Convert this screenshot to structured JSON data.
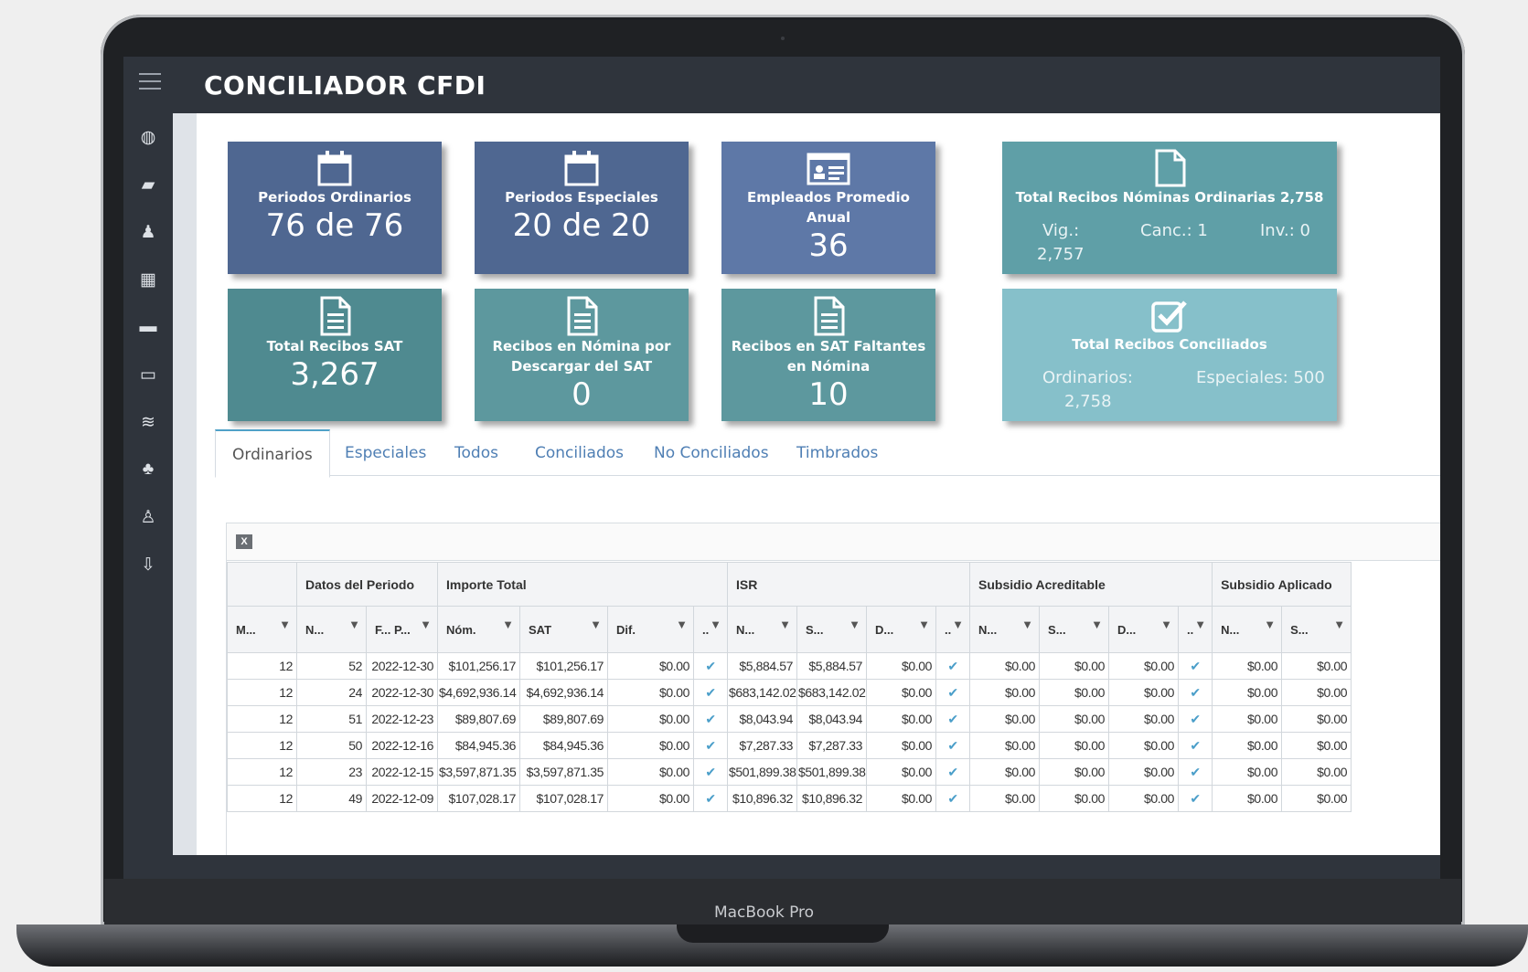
{
  "app": {
    "title": "CONCILIADOR CFDI",
    "device_label": "MacBook Pro"
  },
  "sidebar": {
    "items": [
      {
        "icon": "globe-icon",
        "glyph": "◍"
      },
      {
        "icon": "ticket-icon",
        "glyph": "▰"
      },
      {
        "icon": "person-icon",
        "glyph": "♟"
      },
      {
        "icon": "calendar-icon",
        "glyph": "▦"
      },
      {
        "icon": "archive-icon",
        "glyph": "▬"
      },
      {
        "icon": "id-card-icon",
        "glyph": "▭"
      },
      {
        "icon": "database-icon",
        "glyph": "≋"
      },
      {
        "icon": "group-icon",
        "glyph": "♣"
      },
      {
        "icon": "user-icon",
        "glyph": "♙"
      },
      {
        "icon": "download-icon",
        "glyph": "⇩"
      }
    ]
  },
  "cards": {
    "periodos_ordinarios": {
      "label": "Periodos Ordinarios",
      "value": "76 de 76"
    },
    "periodos_especiales": {
      "label": "Periodos Especiales",
      "value": "20 de 20"
    },
    "empleados": {
      "label": "Empleados Promedio Anual",
      "value": "36"
    },
    "recibos_nominas": {
      "label": "Total Recibos Nóminas Ordinarias 2,758",
      "vig": "Vig.:",
      "vig_val": "2,757",
      "canc": "Canc.: 1",
      "inv": "Inv.: 0"
    },
    "recibos_sat": {
      "label": "Total Recibos SAT",
      "value": "3,267"
    },
    "por_descargar": {
      "label": "Recibos en Nómina por Descargar del SAT",
      "value": "0"
    },
    "faltantes": {
      "label": "Recibos en SAT Faltantes en Nómina",
      "value": "10"
    },
    "conciliados": {
      "label": "Total Recibos Conciliados",
      "ordinarios": "Ordinarios:",
      "ordinarios_val": "2,758",
      "especiales": "Especiales: 500"
    }
  },
  "colors": {
    "navy": "#4f6791",
    "blue": "#5e78a7",
    "teal": "#5d989e",
    "light_teal": "#86c0ca",
    "accent": "#4fa1c8"
  },
  "tabs": [
    "Ordinarios",
    "Especiales",
    "Todos",
    "Conciliados",
    "No Conciliados",
    "Timbrados"
  ],
  "active_tab": "Ordinarios",
  "grid": {
    "group_headers": [
      "",
      "Datos del Periodo",
      "Importe Total",
      "ISR",
      "Subsidio Acreditable",
      "Subsidio Aplicado"
    ],
    "columns": [
      "M...",
      "N...",
      "F... P...",
      "Nóm.",
      "SAT",
      "Dif.",
      "..",
      "N...",
      "S...",
      "D...",
      "..",
      "N...",
      "S...",
      "D...",
      "..",
      "N...",
      "S..."
    ],
    "rows": [
      [
        "12",
        "52",
        "2022-12-30",
        "$101,256.17",
        "$101,256.17",
        "$0.00",
        "✔",
        "$5,884.57",
        "$5,884.57",
        "$0.00",
        "✔",
        "$0.00",
        "$0.00",
        "$0.00",
        "✔",
        "$0.00",
        "$0.00"
      ],
      [
        "12",
        "24",
        "2022-12-30",
        "$4,692,936.14",
        "$4,692,936.14",
        "$0.00",
        "✔",
        "$683,142.02",
        "$683,142.02",
        "$0.00",
        "✔",
        "$0.00",
        "$0.00",
        "$0.00",
        "✔",
        "$0.00",
        "$0.00"
      ],
      [
        "12",
        "51",
        "2022-12-23",
        "$89,807.69",
        "$89,807.69",
        "$0.00",
        "✔",
        "$8,043.94",
        "$8,043.94",
        "$0.00",
        "✔",
        "$0.00",
        "$0.00",
        "$0.00",
        "✔",
        "$0.00",
        "$0.00"
      ],
      [
        "12",
        "50",
        "2022-12-16",
        "$84,945.36",
        "$84,945.36",
        "$0.00",
        "✔",
        "$7,287.33",
        "$7,287.33",
        "$0.00",
        "✔",
        "$0.00",
        "$0.00",
        "$0.00",
        "✔",
        "$0.00",
        "$0.00"
      ],
      [
        "12",
        "23",
        "2022-12-15",
        "$3,597,871.35",
        "$3,597,871.35",
        "$0.00",
        "✔",
        "$501,899.38",
        "$501,899.38",
        "$0.00",
        "✔",
        "$0.00",
        "$0.00",
        "$0.00",
        "✔",
        "$0.00",
        "$0.00"
      ],
      [
        "12",
        "49",
        "2022-12-09",
        "$107,028.17",
        "$107,028.17",
        "$0.00",
        "✔",
        "$10,896.32",
        "$10,896.32",
        "$0.00",
        "✔",
        "$0.00",
        "$0.00",
        "$0.00",
        "✔",
        "$0.00",
        "$0.00"
      ]
    ]
  }
}
